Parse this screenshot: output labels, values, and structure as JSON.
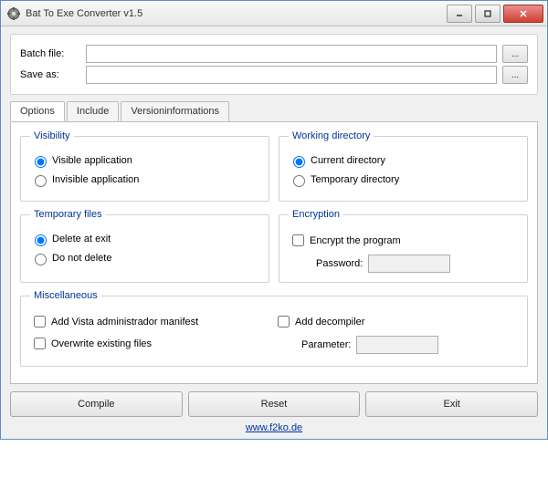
{
  "window": {
    "title": "Bat To Exe Converter v1.5"
  },
  "file": {
    "batch_label": "Batch file:",
    "batch_value": "",
    "save_label": "Save as:",
    "save_value": "",
    "browse_label": "..."
  },
  "tabs": {
    "options": "Options",
    "include": "Include",
    "version": "Versioninformations"
  },
  "visibility": {
    "legend": "Visibility",
    "visible": "Visible application",
    "invisible": "Invisible application"
  },
  "workingdir": {
    "legend": "Working directory",
    "current": "Current directory",
    "temp": "Temporary directory"
  },
  "tempfiles": {
    "legend": "Temporary files",
    "del": "Delete at exit",
    "nodel": "Do not delete"
  },
  "encryption": {
    "legend": "Encryption",
    "encrypt": "Encrypt the program",
    "password_label": "Password:",
    "password_value": ""
  },
  "misc": {
    "legend": "Miscellaneous",
    "manifest": "Add Vista administrador manifest",
    "overwrite": "Overwrite existing files",
    "decompiler": "Add decompiler",
    "param_label": "Parameter:",
    "param_value": ""
  },
  "buttons": {
    "compile": "Compile",
    "reset": "Reset",
    "exit": "Exit"
  },
  "footer": {
    "link": "www.f2ko.de"
  }
}
